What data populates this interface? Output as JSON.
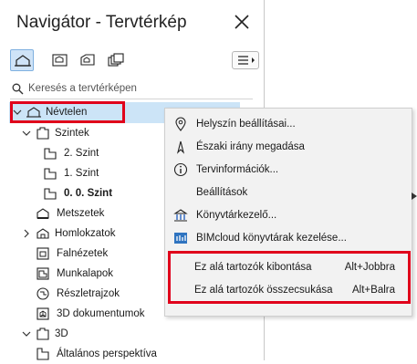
{
  "panel": {
    "title": "Navigátor - Tervtérkép"
  },
  "search": {
    "placeholder": "Keresés a tervtérképen"
  },
  "tree": {
    "root": "Névtelen",
    "stories": "Szintek",
    "story2": "2. Szint",
    "story1": "1. Szint",
    "story0": "0. 0. Szint",
    "sections": "Metszetek",
    "elevations": "Homlokzatok",
    "interior": "Falnézetek",
    "worksheets": "Munkalapok",
    "details": "Részletrajzok",
    "doc3d": "3D dokumentumok",
    "threeD": "3D",
    "generic": "Általános perspektíva"
  },
  "context_menu": {
    "location": "Helyszín beállításai...",
    "north": "Északi irány megadása",
    "projectinfo": "Tervinformációk...",
    "settings": "Beállítások",
    "library": "Könyvtárkezelő...",
    "bimcloud": "BIMcloud könyvtárak kezelése...",
    "expand": "Ez alá tartozók kibontása",
    "expand_key": "Alt+Jobbra",
    "collapse": "Ez alá tartozók összecsukása",
    "collapse_key": "Alt+Balra"
  },
  "colors": {
    "selection": "#cce4f7",
    "highlight_red": "#e0001b",
    "menu_bg": "#f2f2f2"
  }
}
